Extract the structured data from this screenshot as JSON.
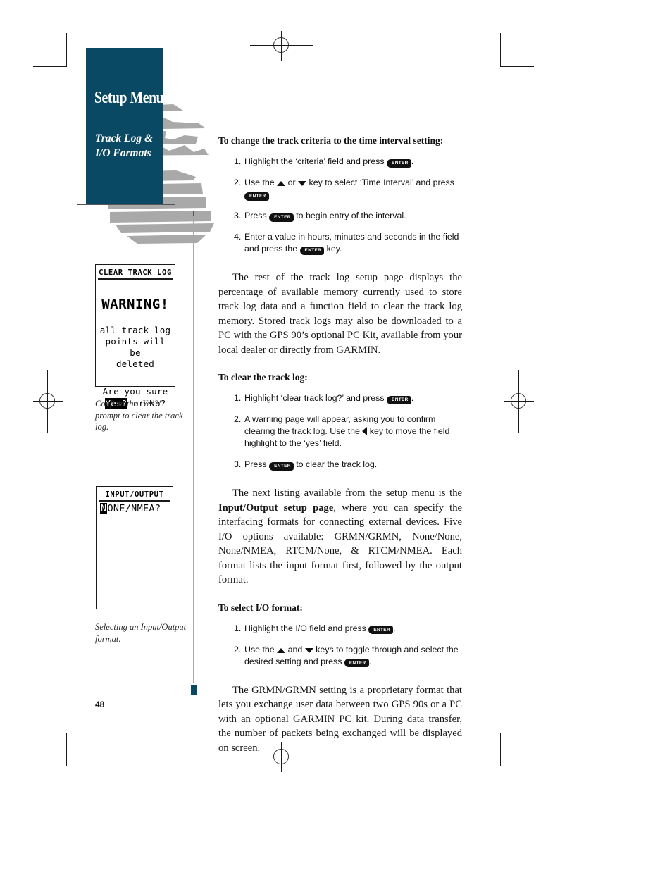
{
  "page": {
    "number": "48",
    "accent_color": "#094963",
    "rule_color": "#a8a8a8"
  },
  "header": {
    "title": "Setup Menu",
    "subtitle_line1": "Track Log &",
    "subtitle_line2": "I/O Formats"
  },
  "figures": [
    {
      "id": "clear-track-log-screen",
      "lcd_title": "CLEAR TRACK LOG",
      "warning": "WARNING!",
      "message_line1": "all track log",
      "message_line2": "points will be",
      "message_line3": "deleted",
      "confirm_line": "Are you sure",
      "confirm_yes": "Yes?",
      "confirm_rest": " or No?",
      "caption": "Confirm the ‘Yes?’ prompt to clear the track log."
    },
    {
      "id": "input-output-screen",
      "lcd_title": "INPUT/OUTPUT",
      "selected_char": "N",
      "value_rest": "ONE/NMEA?",
      "caption": "Selecting an Input/Output format."
    }
  ],
  "main": {
    "section1": {
      "heading": "To change the track criteria to the time interval setting:",
      "steps": [
        {
          "num": "1.",
          "parts": [
            {
              "t": "text",
              "v": "Highlight the ‘criteria’ field and press "
            },
            {
              "t": "key",
              "v": "ENTER"
            },
            {
              "t": "text",
              "v": "."
            }
          ]
        },
        {
          "num": "2.",
          "parts": [
            {
              "t": "text",
              "v": "Use the "
            },
            {
              "t": "tri-up",
              "v": ""
            },
            {
              "t": "text",
              "v": " or "
            },
            {
              "t": "tri-down",
              "v": ""
            },
            {
              "t": "text",
              "v": " key to select ‘Time Interval’ and press "
            },
            {
              "t": "key",
              "v": "ENTER"
            },
            {
              "t": "text",
              "v": "."
            }
          ]
        },
        {
          "num": "3.",
          "parts": [
            {
              "t": "text",
              "v": "Press "
            },
            {
              "t": "key",
              "v": "ENTER"
            },
            {
              "t": "text",
              "v": " to begin entry of the interval."
            }
          ]
        },
        {
          "num": "4.",
          "parts": [
            {
              "t": "text",
              "v": "Enter a value in hours, minutes and seconds in the field and press the "
            },
            {
              "t": "key",
              "v": "ENTER"
            },
            {
              "t": "text",
              "v": " key."
            }
          ]
        }
      ]
    },
    "paragraph1": "The rest of the track log setup page displays the percentage of available memory currently used to store track log data and a function field to clear the track log memory. Stored track logs may also be downloaded to a PC with the GPS 90’s optional PC Kit, available from your local dealer or directly from GARMIN.",
    "section2": {
      "heading": "To clear the track log:",
      "steps": [
        {
          "num": "1.",
          "parts": [
            {
              "t": "text",
              "v": "Highlight ‘clear track log?’ and press "
            },
            {
              "t": "key",
              "v": "ENTER"
            },
            {
              "t": "text",
              "v": "."
            }
          ]
        },
        {
          "num": "2.",
          "parts": [
            {
              "t": "text",
              "v": "A warning page will appear, asking you to confirm clearing the track log. Use the "
            },
            {
              "t": "tri-left",
              "v": ""
            },
            {
              "t": "text",
              "v": " key to move the field highlight to the ‘yes’ field."
            }
          ]
        },
        {
          "num": "3.",
          "parts": [
            {
              "t": "text",
              "v": "Press "
            },
            {
              "t": "key",
              "v": "ENTER"
            },
            {
              "t": "text",
              "v": " to clear the track log."
            }
          ]
        }
      ]
    },
    "paragraph2_a": "The next listing available from the setup menu is the ",
    "paragraph2_bold": "Input/Output setup page",
    "paragraph2_b": ", where you can specify the interfacing formats for connecting external devices. Five I/O options available: GRMN/GRMN, None/None, None/NMEA, RTCM/None, & RTCM/NMEA. Each format lists the input format first, followed by the output format.",
    "section3": {
      "heading": "To select I/O format:",
      "steps": [
        {
          "num": "1.",
          "parts": [
            {
              "t": "text",
              "v": "Highlight the I/O field and press "
            },
            {
              "t": "key",
              "v": "ENTER"
            },
            {
              "t": "text",
              "v": "."
            }
          ]
        },
        {
          "num": "2.",
          "parts": [
            {
              "t": "text",
              "v": "Use the "
            },
            {
              "t": "tri-up",
              "v": ""
            },
            {
              "t": "text",
              "v": " and "
            },
            {
              "t": "tri-down",
              "v": ""
            },
            {
              "t": "text",
              "v": " keys to toggle through and select the desired setting and press "
            },
            {
              "t": "key",
              "v": "ENTER"
            },
            {
              "t": "text",
              "v": "."
            }
          ]
        }
      ]
    },
    "paragraph3": "The GRMN/GRMN setting is a proprietary format that lets you exchange user data between two GPS 90s or a PC with an optional GARMIN PC kit. During data transfer, the number of packets being exchanged will be displayed on screen."
  }
}
